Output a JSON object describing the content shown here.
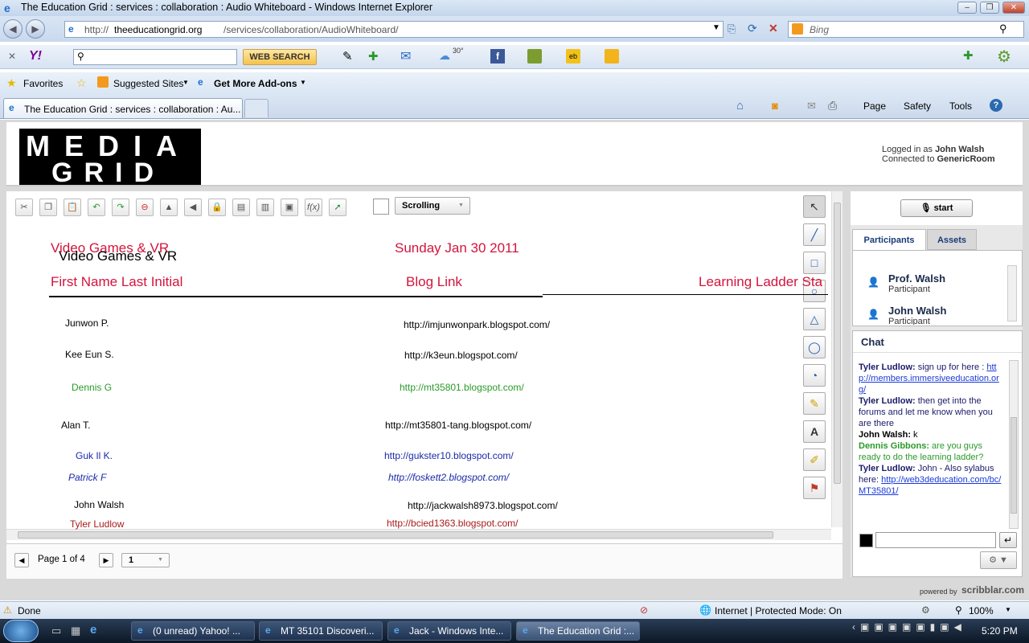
{
  "window": {
    "title": "The Education Grid : services : collaboration : Audio Whiteboard - Windows Internet Explorer"
  },
  "address": {
    "url_prefix": "http://",
    "url_domain": "theeducationgrid.org",
    "url_path": "/services/collaboration/AudioWhiteboard/",
    "search_placeholder": "Bing"
  },
  "yahoo": {
    "search_button": "WEB SEARCH",
    "weather": "30°"
  },
  "favorites": {
    "favorites": "Favorites",
    "suggested": "Suggested Sites",
    "addons": "Get More Add-ons"
  },
  "tab": {
    "title": "The Education Grid : services : collaboration : Au..."
  },
  "commandbar": {
    "page": "Page",
    "safety": "Safety",
    "tools": "Tools"
  },
  "header": {
    "logged_label": "Logged in as",
    "user": "John Walsh",
    "connected_label": "Connected to",
    "room": "GenericRoom"
  },
  "whiteboard": {
    "mode": "Scrolling",
    "title_red": "Video Games & VR",
    "title_black": "Video Games & VR",
    "date": "Sunday Jan 30 2011",
    "col1": "First Name Last Initial",
    "col2": "Blog Link",
    "col3": "Learning Ladder Sta",
    "rows": [
      {
        "name": "Junwon P.",
        "link": "http://imjunwonpark.blogspot.com/"
      },
      {
        "name": "Kee Eun S.",
        "link": "http://k3eun.blogspot.com/"
      },
      {
        "name": "Dennis G",
        "link": "http://mt35801.blogspot.com/"
      },
      {
        "name": "Alan T.",
        "link": "http://mt35801-tang.blogspot.com/"
      },
      {
        "name": "Guk Il K.",
        "link": "http://gukster10.blogspot.com/"
      },
      {
        "name": "Patrick F",
        "link": "http://foskett2.blogspot.com/"
      },
      {
        "name": "John Walsh",
        "link": "http://jackwalsh8973.blogspot.com/"
      },
      {
        "name": "Tyler Ludlow",
        "link": "http://bcied1363.blogspot.com/"
      }
    ],
    "page_label": "Page 1 of 4",
    "page_select": "1"
  },
  "right": {
    "start": "start",
    "tab_participants": "Participants",
    "tab_assets": "Assets",
    "participants": [
      {
        "name": "Prof. Walsh",
        "role": "Participant"
      },
      {
        "name": "John Walsh",
        "role": "Participant"
      }
    ],
    "chat_title": "Chat",
    "chat": [
      {
        "who": "Tyler Ludlow:",
        "msg": " sign up for here : ",
        "link": "http://members.immersiveeducation.org/"
      },
      {
        "who": "Tyler Ludlow:",
        "msg": " then get into the forums and let me know when you are there",
        "link": ""
      },
      {
        "who": "John Walsh:",
        "msg": " k",
        "link": ""
      },
      {
        "who": "Dennis Gibbons:",
        "msg": " are you guys ready to do the learning ladder?",
        "link": ""
      },
      {
        "who": "Tyler Ludlow:",
        "msg": " John - Also sylabus here: ",
        "link": "http://web3deducation.com/bc/MT35801/"
      }
    ],
    "powered": "powered by",
    "brand": "scribblar.com"
  },
  "status": {
    "done": "Done",
    "zone": "Internet | Protected Mode: On",
    "zoom": "100%"
  },
  "taskbar": {
    "items": [
      "(0 unread) Yahoo! ...",
      "MT 35101 Discoveri...",
      "Jack - Windows Inte...",
      "The Education Grid :..."
    ],
    "time": "5:20 PM"
  }
}
